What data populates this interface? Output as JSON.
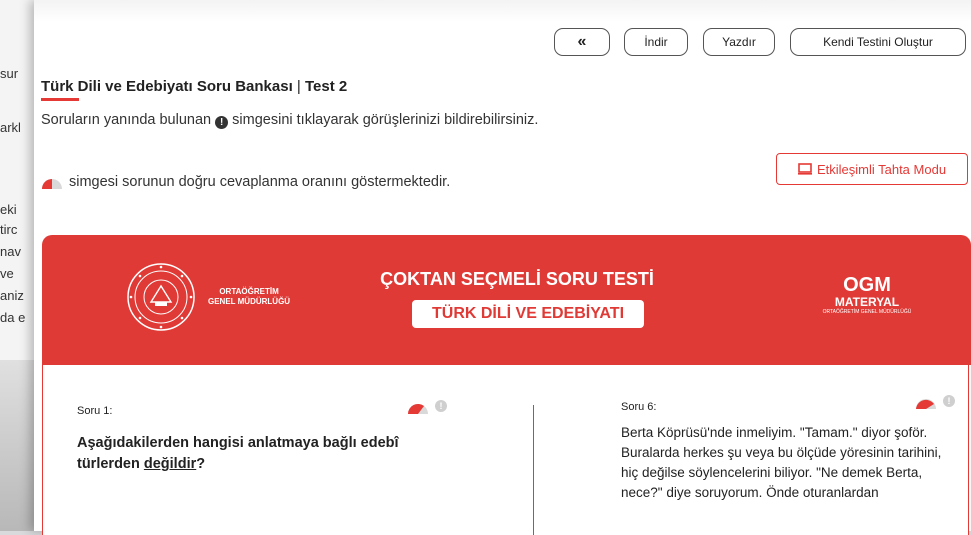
{
  "background_fragments": [
    "sur",
    "arkl",
    "eki",
    "tirc",
    "nav",
    "ve",
    "aniz",
    "da e"
  ],
  "toolbar": {
    "back_label": "«",
    "download_label": "İndir",
    "print_label": "Yazdır",
    "create_label": "Kendi Testini Oluştur"
  },
  "header": {
    "title": "Türk Dili ve Edebiyatı Soru Bankası",
    "separator": "|",
    "test_label": "Test 2"
  },
  "info": {
    "line1_pre": "Soruların yanında bulunan",
    "line1_post": "simgesini tıklayarak görüşlerinizi bildirebilirsiniz.",
    "line2": "simgesi sorunun doğru cevaplanma oranını göstermektedir."
  },
  "board_mode_label": "Etkileşimli Tahta Modu",
  "banner": {
    "org_line1": "ORTAÖĞRETİM",
    "org_line2": "GENEL MÜDÜRLÜĞÜ",
    "title": "ÇOKTAN SEÇMELİ SORU TESTİ",
    "subject": "TÜRK DİLİ VE EDEBİYATI",
    "ogm_l1": "OGM",
    "ogm_l2": "MATERYAL",
    "ogm_l3": "ORTAÖĞRETİM GENEL MÜDÜRLÜĞÜ"
  },
  "questions": {
    "q1": {
      "label": "Soru 1:",
      "text_pre": "Aşağıdakilerden hangisi anlatmaya bağlı edebî türlerden",
      "text_underlined": "değildir",
      "text_post": "?"
    },
    "q6": {
      "label": "Soru 6:",
      "text": "Berta Köprüsü'nde inmeliyim. \"Tamam.\" diyor şoför. Buralarda herkes şu veya bu ölçüde yöresinin tarihini, hiç değilse söylencelerini biliyor. \"Ne demek Berta, nece?\" diye soruyorum. Önde oturanlardan"
    }
  },
  "colors": {
    "accent": "#e53935",
    "banner": "#e03a36"
  }
}
